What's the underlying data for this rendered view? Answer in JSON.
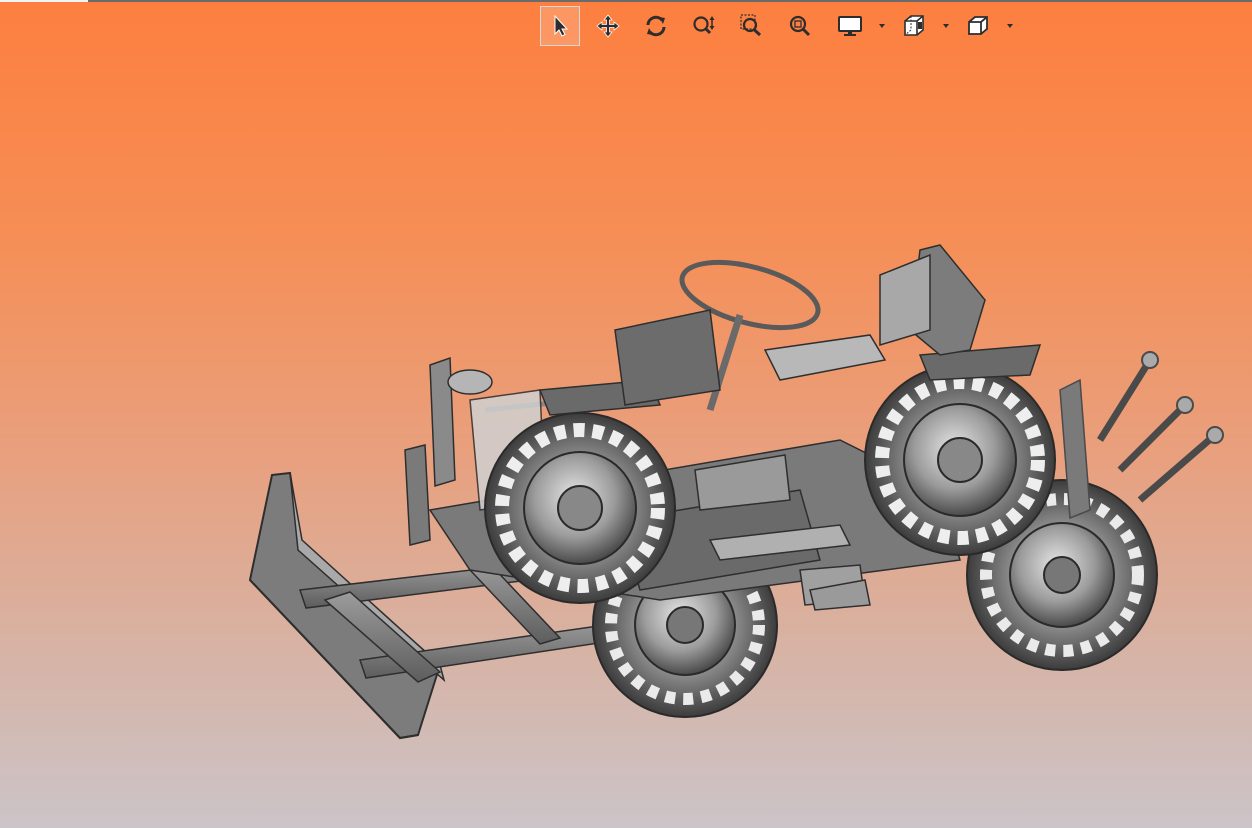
{
  "app": {
    "viewport_background": {
      "top_color": "#fd7f3f",
      "bottom_color": "#cbc4c8"
    }
  },
  "toolbar": {
    "buttons": [
      {
        "name": "select",
        "icon": "cursor-arrow-icon",
        "active": true
      },
      {
        "name": "pan",
        "icon": "move-arrows-icon",
        "active": false
      },
      {
        "name": "rotate",
        "icon": "rotate-icon",
        "active": false
      },
      {
        "name": "zoom",
        "icon": "zoom-updown-icon",
        "active": false
      },
      {
        "name": "zoom-window",
        "icon": "zoom-window-icon",
        "active": false
      },
      {
        "name": "zoom-fit",
        "icon": "zoom-fit-icon",
        "active": false
      },
      {
        "name": "display-mode",
        "icon": "monitor-icon",
        "active": false,
        "dropdown": true
      },
      {
        "name": "section-view",
        "icon": "section-cube-icon",
        "active": false,
        "dropdown": true
      },
      {
        "name": "view-orientation",
        "icon": "cube-icon",
        "active": false,
        "dropdown": true
      }
    ]
  },
  "model": {
    "description_icon": "tractor-model",
    "colors": {
      "body": "#7a7a7a",
      "dark": "#3a3a3a",
      "light": "#c9c9c9"
    }
  }
}
